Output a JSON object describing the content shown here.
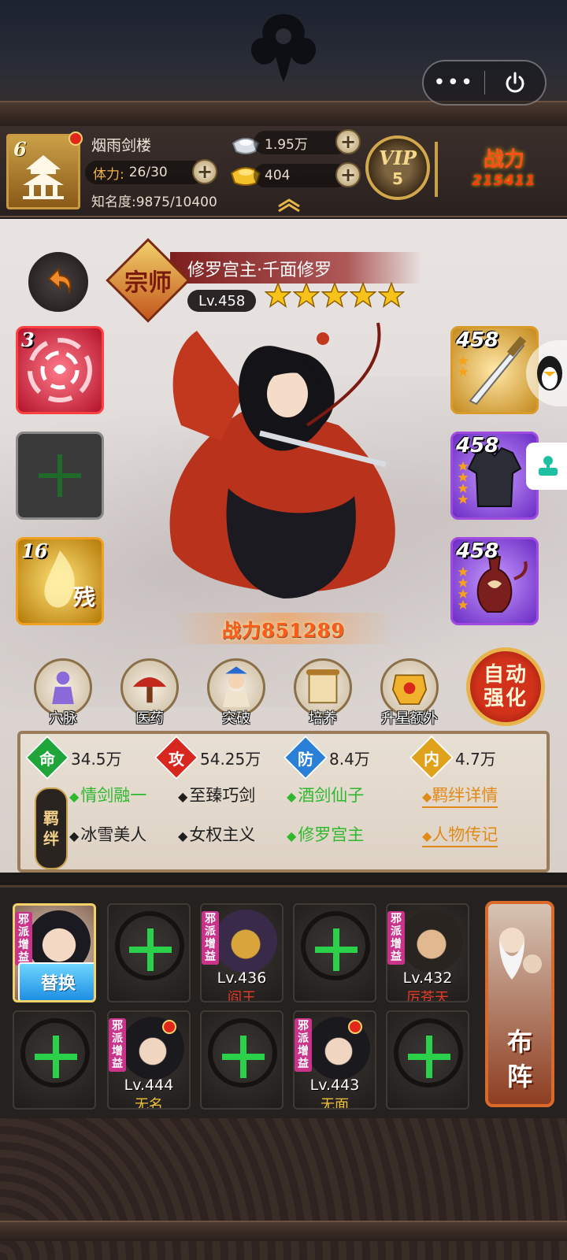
{
  "header": {
    "menu_dots": "•••",
    "player_level": "6",
    "player_name": "烟雨剑楼",
    "stamina_label": "体力:",
    "stamina_value": "26/30",
    "fame_label": "知名度:",
    "fame_value": "9875/10400",
    "silver": "1.95万",
    "gold": "404",
    "vip_label": "VIP",
    "vip_level": "5",
    "combat_label": "战力",
    "combat_value": "215411"
  },
  "hero": {
    "title_badge": "宗师",
    "name": "修罗宫主·千面修罗",
    "level": "Lv.458",
    "stars": 5,
    "power": "战力851289"
  },
  "skills": [
    {
      "level": "3"
    },
    {
      "level": ""
    },
    {
      "level": "16",
      "mark": "残"
    }
  ],
  "equipment": [
    {
      "level": "458",
      "stars": 2
    },
    {
      "level": "458",
      "stars": 4
    },
    {
      "level": "458",
      "stars": 4
    }
  ],
  "functions": [
    {
      "label": "穴脉"
    },
    {
      "label": "医药"
    },
    {
      "label": "突破"
    },
    {
      "label": "培养"
    },
    {
      "label": "升星额外"
    }
  ],
  "auto_button": {
    "line1": "自动",
    "line2": "强化"
  },
  "stats": {
    "hp": {
      "icon": "命",
      "value": "34.5万"
    },
    "atk": {
      "icon": "攻",
      "value": "54.25万"
    },
    "def": {
      "icon": "防",
      "value": "8.4万"
    },
    "inner": {
      "icon": "内",
      "value": "4.7万"
    }
  },
  "bonds": {
    "badge_line1": "羁",
    "badge_line2": "绊",
    "items": [
      {
        "name": "情剑融一",
        "active": true
      },
      {
        "name": "至臻巧剑",
        "active": false
      },
      {
        "name": "酒剑仙子",
        "active": true
      },
      {
        "name": "冰雪美人",
        "active": false
      },
      {
        "name": "女权主义",
        "active": false
      },
      {
        "name": "修罗宫主",
        "active": true
      }
    ],
    "link_details": "羁绊详情",
    "link_biography": "人物传记"
  },
  "formation": {
    "replace_label": "替换",
    "tag": "邪派增益",
    "members": [
      {
        "level": "Lv.436",
        "name": "阎王"
      },
      {
        "level": "Lv.432",
        "name": "厉苍天"
      },
      {
        "level": "Lv.444",
        "name": "无名"
      },
      {
        "level": "Lv.443",
        "name": "无面"
      }
    ],
    "deploy_line1": "布",
    "deploy_line2": "阵"
  },
  "colors": {
    "hp": "#1fa53a",
    "atk": "#d8271f",
    "def": "#2a7fd6",
    "inner": "#e0a21a",
    "bond_active": "#2eb82e",
    "link": "#e08a1a"
  }
}
